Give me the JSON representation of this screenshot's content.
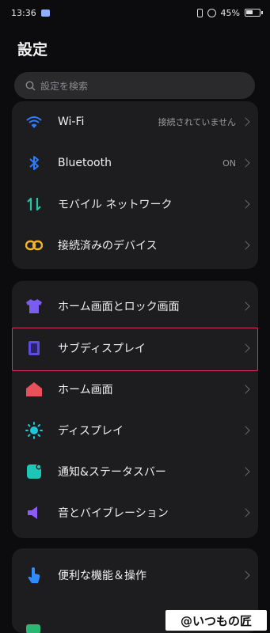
{
  "status_bar": {
    "time": "13:36",
    "battery_pct": "45%"
  },
  "page_title": "設定",
  "search": {
    "placeholder": "設定を検索"
  },
  "card1": [
    {
      "label": "Wi-Fi",
      "value": "接続されていません",
      "icon": "wifi-icon"
    },
    {
      "label": "Bluetooth",
      "value": "ON",
      "icon": "bluetooth-icon"
    },
    {
      "label": "モバイル ネットワーク",
      "value": "",
      "icon": "mobile-network-icon"
    },
    {
      "label": "接続済みのデバイス",
      "value": "",
      "icon": "connected-devices-icon"
    }
  ],
  "card2": [
    {
      "label": "ホーム画面とロック画面",
      "icon": "shirt-icon"
    },
    {
      "label": "サブディスプレイ",
      "icon": "sub-display-icon",
      "highlighted": true
    },
    {
      "label": "ホーム画面",
      "icon": "home-icon"
    },
    {
      "label": "ディスプレイ",
      "icon": "brightness-icon"
    },
    {
      "label": "通知&ステータスバー",
      "icon": "notification-icon"
    },
    {
      "label": "音とバイブレーション",
      "icon": "speaker-icon"
    }
  ],
  "card3": [
    {
      "label": "便利な機能＆操作",
      "icon": "hand-tap-icon"
    }
  ],
  "watermark": "@いつもの匠",
  "colors": {
    "background": "#0c0c0e",
    "card": "#1d1d1f",
    "highlight_border": "#d2345a"
  }
}
